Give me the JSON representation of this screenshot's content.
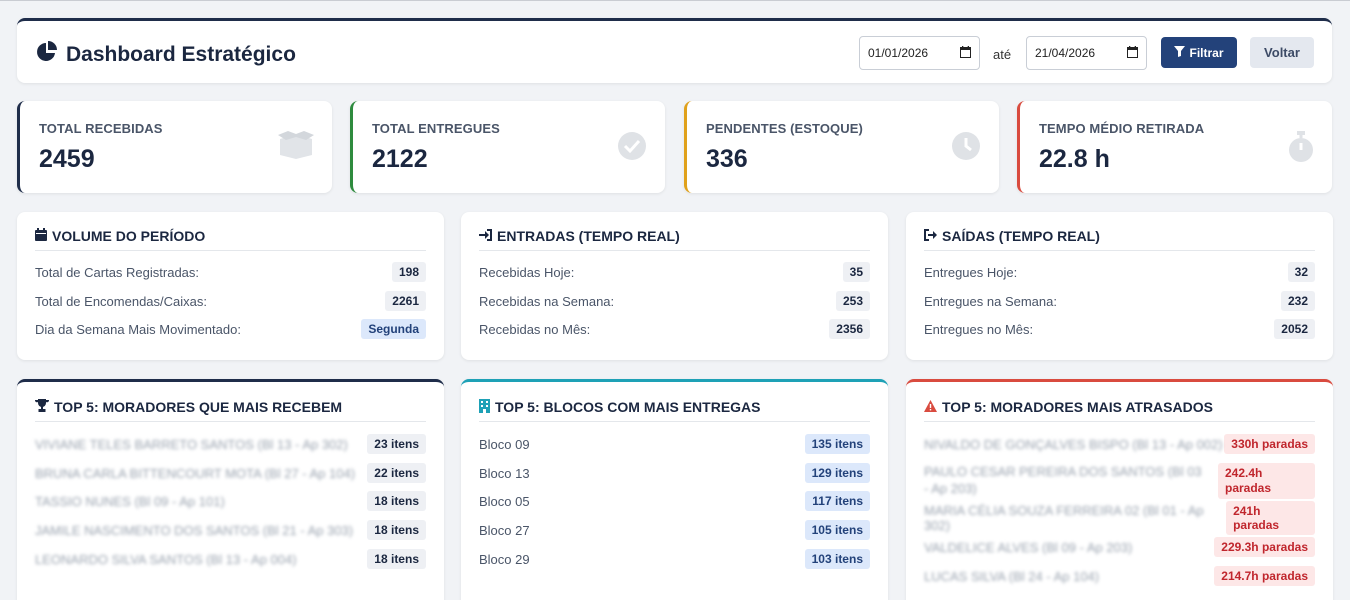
{
  "header": {
    "title": "Dashboard Estratégico",
    "date_from": "01/01/2026",
    "date_sep": "até",
    "date_to": "21/04/2026",
    "filter_label": "Filtrar",
    "back_label": "Voltar"
  },
  "kpis": [
    {
      "label": "TOTAL RECEBIDAS",
      "value": "2459",
      "icon": "box-icon",
      "color": "#1f2d4a"
    },
    {
      "label": "TOTAL ENTREGUES",
      "value": "2122",
      "icon": "check-circle-icon",
      "color": "#2e8b3e"
    },
    {
      "label": "PENDENTES (ESTOQUE)",
      "value": "336",
      "icon": "clock-icon",
      "color": "#e0a11b"
    },
    {
      "label": "TEMPO MÉDIO RETIRADA",
      "value": "22.8 h",
      "icon": "stopwatch-icon",
      "color": "#d94b3f"
    }
  ],
  "volume": {
    "title": "VOLUME DO PERÍODO",
    "rows": [
      {
        "label": "Total de Cartas Registradas:",
        "value": "198"
      },
      {
        "label": "Total de Encomendas/Caixas:",
        "value": "2261"
      },
      {
        "label": "Dia da Semana Mais Movimentado:",
        "value": "Segunda"
      }
    ]
  },
  "entradas": {
    "title": "ENTRADAS (TEMPO REAL)",
    "rows": [
      {
        "label": "Recebidas Hoje:",
        "value": "35"
      },
      {
        "label": "Recebidas na Semana:",
        "value": "253"
      },
      {
        "label": "Recebidas no Mês:",
        "value": "2356"
      }
    ]
  },
  "saidas": {
    "title": "SAÍDAS (TEMPO REAL)",
    "rows": [
      {
        "label": "Entregues Hoje:",
        "value": "32"
      },
      {
        "label": "Entregues na Semana:",
        "value": "232"
      },
      {
        "label": "Entregues no Mês:",
        "value": "2052"
      }
    ]
  },
  "top_moradores": {
    "title": "TOP 5: MORADORES QUE MAIS RECEBEM",
    "rows": [
      {
        "label": "VIVIANE TELES BARRETO SANTOS (Bl 13 - Ap 302)",
        "value": "23 itens"
      },
      {
        "label": "BRUNA CARLA BITTENCOURT MOTA (Bl 27 - Ap 104)",
        "value": "22 itens"
      },
      {
        "label": "TASSIO NUNES (Bl 09 - Ap 101)",
        "value": "18 itens"
      },
      {
        "label": "JAMILE NASCIMENTO DOS SANTOS (Bl 21 - Ap 303)",
        "value": "18 itens"
      },
      {
        "label": "LEONARDO SILVA SANTOS (Bl 13 - Ap 004)",
        "value": "18 itens"
      }
    ]
  },
  "top_blocos": {
    "title": "TOP 5: BLOCOS COM MAIS ENTREGAS",
    "rows": [
      {
        "label": "Bloco 09",
        "value": "135 itens"
      },
      {
        "label": "Bloco 13",
        "value": "129 itens"
      },
      {
        "label": "Bloco 05",
        "value": "117 itens"
      },
      {
        "label": "Bloco 27",
        "value": "105 itens"
      },
      {
        "label": "Bloco 29",
        "value": "103 itens"
      }
    ]
  },
  "top_atrasados": {
    "title": "TOP 5: MORADORES MAIS ATRASADOS",
    "rows": [
      {
        "label": "NIVALDO DE GONÇALVES BISPO (Bl 13 - Ap 002)",
        "value": "330h paradas"
      },
      {
        "label": "PAULO CESAR PEREIRA DOS SANTOS (Bl 03 - Ap 203)",
        "value": "242.4h paradas"
      },
      {
        "label": "MARIA CÉLIA SOUZA FERREIRA 02 (Bl 01 - Ap 302)",
        "value": "241h paradas"
      },
      {
        "label": "VALDELICE ALVES (Bl 09 - Ap 203)",
        "value": "229.3h paradas"
      },
      {
        "label": "LUCAS SILVA (Bl 24 - Ap 104)",
        "value": "214.7h paradas"
      }
    ]
  }
}
